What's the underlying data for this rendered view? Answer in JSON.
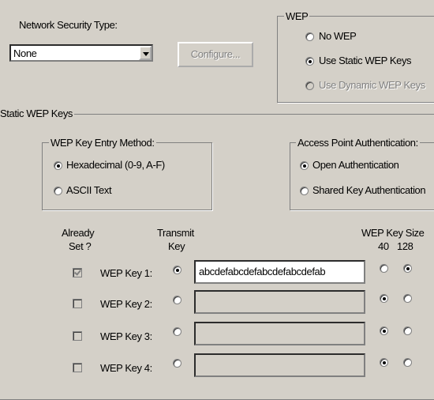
{
  "network_security_type": {
    "label": "Network Security Type:",
    "selected": "None"
  },
  "configure_button": "Configure...",
  "wep_group": {
    "title": "WEP",
    "options": [
      {
        "label": "No WEP",
        "selected": false,
        "disabled": false
      },
      {
        "label": "Use Static WEP Keys",
        "selected": true,
        "disabled": false
      },
      {
        "label": "Use Dynamic WEP Keys",
        "selected": false,
        "disabled": true
      }
    ]
  },
  "static_wep_keys": {
    "title": "Static WEP Keys"
  },
  "entry_method": {
    "title": "WEP Key Entry Method:",
    "options": [
      {
        "label": "Hexadecimal (0-9, A-F)",
        "selected": true
      },
      {
        "label": "ASCII Text",
        "selected": false
      }
    ]
  },
  "ap_auth": {
    "title": "Access Point Authentication:",
    "options": [
      {
        "label": "Open Authentication",
        "selected": true
      },
      {
        "label": "Shared Key Authentication",
        "selected": false
      }
    ]
  },
  "headers": {
    "already_set_1": "Already",
    "already_set_2": "Set ?",
    "transmit_1": "Transmit",
    "transmit_2": "Key",
    "key_size": "WEP Key Size",
    "size_40": "40",
    "size_128": "128"
  },
  "keys": [
    {
      "label": "WEP Key 1:",
      "already_set": true,
      "transmit": true,
      "value": "abcdefabcdefabcdefabcdefab",
      "size": "128"
    },
    {
      "label": "WEP Key 2:",
      "already_set": false,
      "transmit": false,
      "value": "",
      "size": "40"
    },
    {
      "label": "WEP Key 3:",
      "already_set": false,
      "transmit": false,
      "value": "",
      "size": "40"
    },
    {
      "label": "WEP Key 4:",
      "already_set": false,
      "transmit": false,
      "value": "",
      "size": "40"
    }
  ]
}
